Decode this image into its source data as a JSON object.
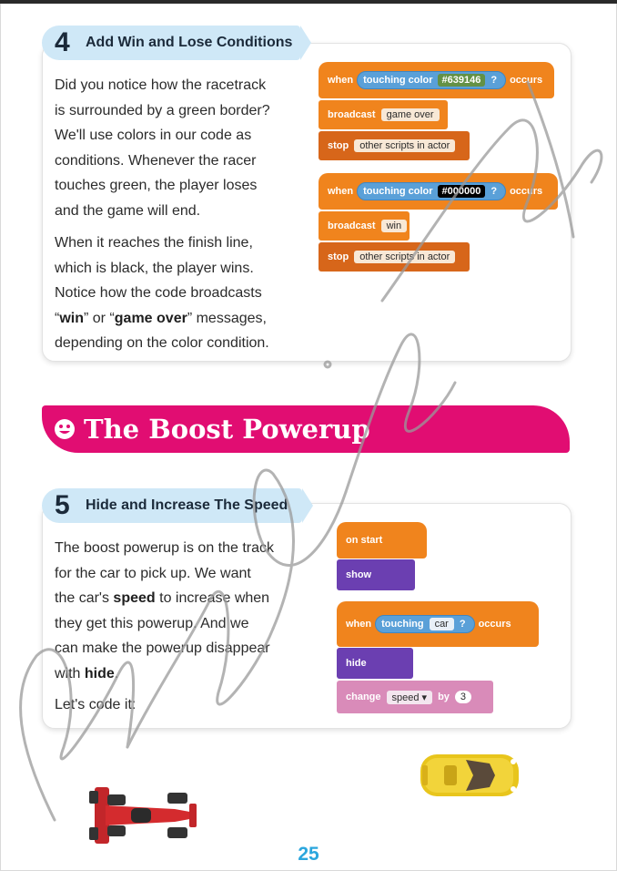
{
  "section4": {
    "number": "4",
    "title": "Add Win and Lose Conditions",
    "paragraph1": [
      "Did you notice how the racetrack",
      "is surrounded by a green border?",
      "We'll use colors in our code as",
      "conditions. Whenever the racer",
      "touches green, the player loses",
      "and the game will end."
    ],
    "paragraph2_lines": [
      "When it reaches the finish line,",
      "which is black, the player wins.",
      "Notice how the code broadcasts"
    ],
    "p2_l4_q1": "“",
    "p2_l4_win": "win",
    "p2_l4_mid": "” or “",
    "p2_l4_gameover": "game over",
    "p2_l4_end": "” messages,",
    "p2_l5": "depending on the color condition.",
    "blocks": {
      "when": "when",
      "touching_color": "touching color",
      "green_hex": "#639146",
      "black_hex": "#000000",
      "qmark": "?",
      "occurs": "occurs",
      "broadcast": "broadcast",
      "game_over": "game over",
      "win": "win",
      "stop": "stop",
      "other_scripts": "other scripts in actor"
    }
  },
  "banner": {
    "title": "The Boost Powerup",
    "icon": "smiley-icon"
  },
  "section5": {
    "number": "5",
    "title": "Hide and Increase The Speed",
    "lines": {
      "l1": "The boost powerup is on the track",
      "l2": "for the car to pick up. We want",
      "l3a": "the car's ",
      "l3b": "speed",
      "l3c": " to increase when",
      "l4": "they get this powerup. And we",
      "l5": "can make the powerup disappear",
      "l6a": "with ",
      "l6b": "hide",
      "l6c": ".",
      "l7": "Let's code it:"
    },
    "blocks": {
      "on_start": "on start",
      "show": "show",
      "when": "when",
      "touching": "touching",
      "car": "car",
      "qmark": "?",
      "occurs": "occurs",
      "hide": "hide",
      "change": "change",
      "speed": "speed",
      "by": "by",
      "amount": "3"
    }
  },
  "page_number": "25",
  "colors": {
    "block_orange": "#f0841d",
    "block_purple": "#6b3fb1",
    "banner_pink": "#e10d72",
    "tab_blue": "#cfe8f7"
  }
}
